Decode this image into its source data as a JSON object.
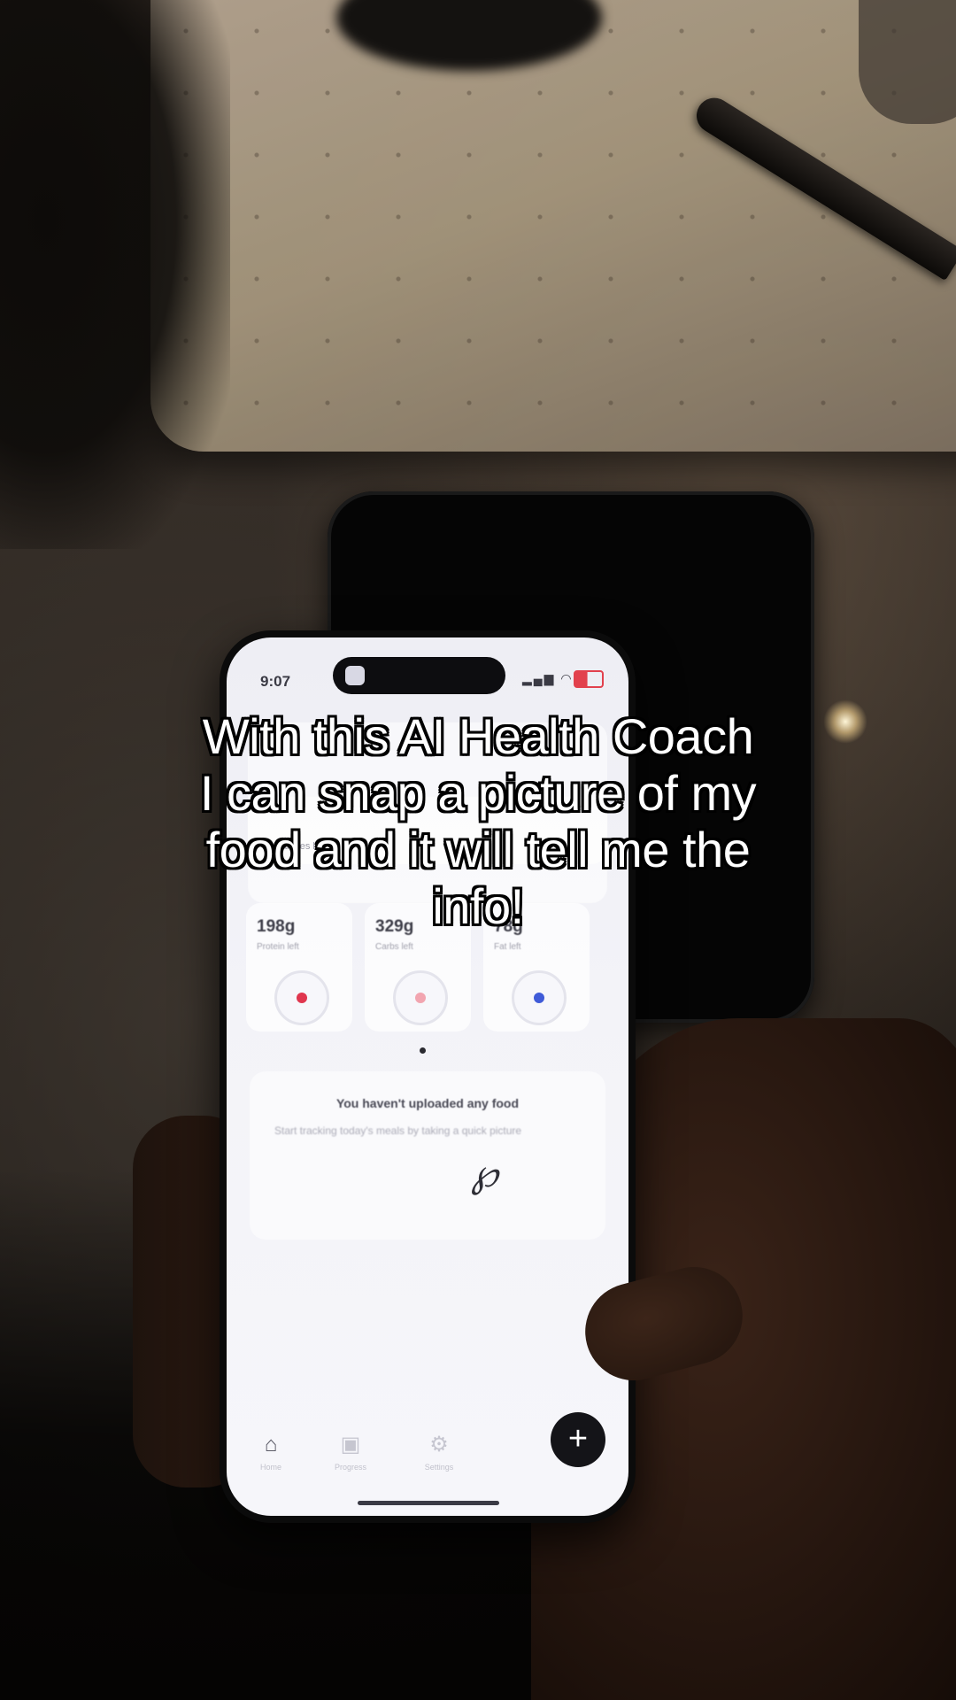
{
  "caption": {
    "line1": "With this AI Health Coach",
    "line2": "I can snap a picture of my",
    "line3": "food and it will tell me the",
    "line4": "info!"
  },
  "phone": {
    "status": {
      "time": "9:07"
    },
    "macros": [
      {
        "value": "198g",
        "label": "Protein left",
        "color": "#e0364e"
      },
      {
        "value": "329g",
        "label": "Carbs left",
        "color": "#f2a5b0"
      },
      {
        "value": "78g",
        "label": "Fat left",
        "color": "#3f5bd8"
      }
    ],
    "calories_caption": "Calories left",
    "empty_state": {
      "title": "You haven't uploaded any food",
      "subtitle": "Start tracking today's meals by taking a quick picture"
    },
    "nav": [
      {
        "label": "Home",
        "icon": "home-icon"
      },
      {
        "label": "Progress",
        "icon": "progress-icon"
      },
      {
        "label": "Settings",
        "icon": "settings-icon"
      }
    ],
    "fab_label": "+"
  }
}
